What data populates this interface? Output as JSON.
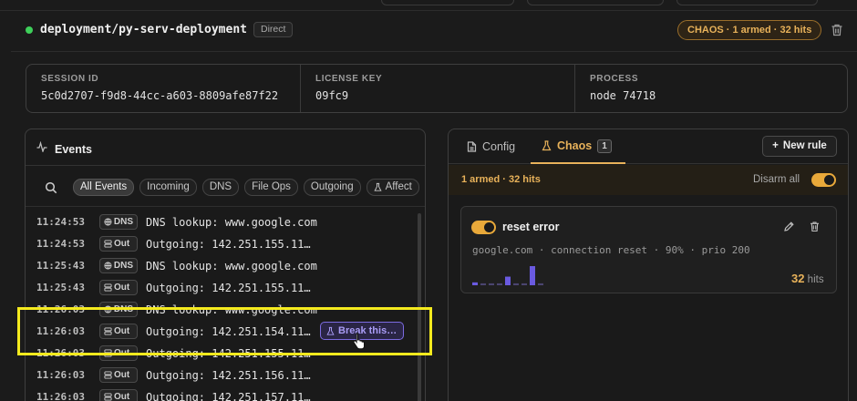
{
  "header": {
    "deployment_name": "deployment/py-serv-deployment",
    "connection_badge": "Direct",
    "chaos_badge": "CHAOS · 1 armed · 32 hits"
  },
  "session": {
    "fields": [
      {
        "label": "SESSION ID",
        "value": "5c0d2707-f9d8-44cc-a603-8809afe87f22"
      },
      {
        "label": "LICENSE KEY",
        "value": "09fc9"
      },
      {
        "label": "PROCESS",
        "value": "node 74718"
      }
    ]
  },
  "events": {
    "title": "Events",
    "filters": [
      {
        "label": "All Events",
        "active": true
      },
      {
        "label": "Incoming",
        "active": false
      },
      {
        "label": "DNS",
        "active": false
      },
      {
        "label": "File Ops",
        "active": false
      },
      {
        "label": "Outgoing",
        "active": false
      },
      {
        "label": "Affect",
        "active": false
      }
    ],
    "rows": [
      {
        "time": "11:24:53",
        "type": "DNS",
        "message": "DNS lookup: www.google.com"
      },
      {
        "time": "11:24:53",
        "type": "Out",
        "message": "Outgoing: 142.251.155.11…"
      },
      {
        "time": "11:25:43",
        "type": "DNS",
        "message": "DNS lookup: www.google.com"
      },
      {
        "time": "11:25:43",
        "type": "Out",
        "message": "Outgoing: 142.251.155.11…"
      },
      {
        "time": "11:26:03",
        "type": "DNS",
        "message": "DNS lookup: www.google.com"
      },
      {
        "time": "11:26:03",
        "type": "Out",
        "message": "Outgoing: 142.251.154.11…",
        "action": "Break this…"
      },
      {
        "time": "11:26:03",
        "type": "Out",
        "message": "Outgoing: 142.251.155.11…"
      },
      {
        "time": "11:26:03",
        "type": "Out",
        "message": "Outgoing: 142.251.156.11…"
      },
      {
        "time": "11:26:03",
        "type": "Out",
        "message": "Outgoing: 142.251.157.11…"
      }
    ]
  },
  "chaos": {
    "tabs": [
      {
        "label": "Config"
      },
      {
        "label": "Chaos",
        "count": "1"
      }
    ],
    "new_rule_label": "New rule",
    "armed_summary": "1 armed · 32 hits",
    "disarm_label": "Disarm all",
    "disarm_enabled": true,
    "rule": {
      "name": "reset error",
      "enabled": true,
      "description": "google.com · connection reset · 90% · prio 200",
      "hits_value": "32",
      "hits_label": "hits",
      "sparkline": [
        0.15,
        0.1,
        0.1,
        0.1,
        0.45,
        0.1,
        0.1,
        1.0,
        0.1
      ]
    }
  },
  "colors": {
    "accent": "#e8b25a",
    "armed_toggle": "#e9a93a",
    "status_ok": "#3ecf5a",
    "break_button": "#7c6be0",
    "sparkline": "#6a5ae0",
    "highlight": "#f4ea1e"
  }
}
